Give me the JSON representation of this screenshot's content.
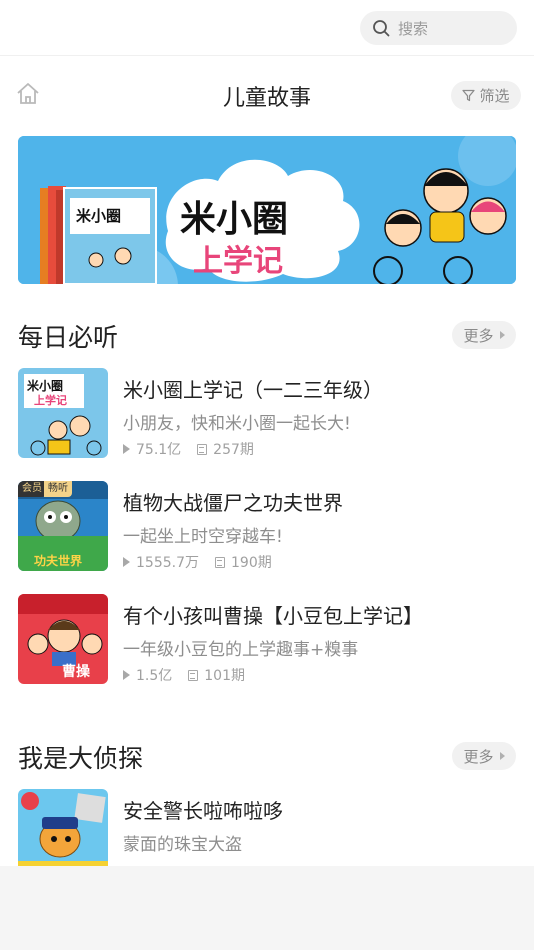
{
  "search": {
    "placeholder": "搜索",
    "icon": "search-icon"
  },
  "header": {
    "title": "儿童故事",
    "filter_label": "筛选",
    "home_icon": "home-icon",
    "filter_icon": "filter-icon"
  },
  "banner": {
    "logo_line1": "米小圈",
    "logo_line2": "上学记",
    "colors": {
      "background": "#4fb4ea"
    }
  },
  "sections": [
    {
      "title": "每日必听",
      "more_label": "更多",
      "items": [
        {
          "title": "米小圈上学记（一二三年级）",
          "subtitle": "小朋友，快和米小圈一起长大!",
          "plays": "75.1亿",
          "episodes": "257期"
        },
        {
          "title": "植物大战僵尸之功夫世界",
          "subtitle": "一起坐上时空穿越车!",
          "plays": "1555.7万",
          "episodes": "190期",
          "badges": [
            "会员",
            "畅听"
          ],
          "cover_text": "功夫世界"
        },
        {
          "title": "有个小孩叫曹操【小豆包上学记】",
          "subtitle": "一年级小豆包的上学趣事+糗事",
          "plays": "1.5亿",
          "episodes": "101期",
          "cover_text": "曹操"
        }
      ]
    },
    {
      "title": "我是大侦探",
      "more_label": "更多",
      "items": [
        {
          "title": "安全警长啦咘啦哆",
          "subtitle": "蒙面的珠宝大盗"
        }
      ]
    }
  ]
}
